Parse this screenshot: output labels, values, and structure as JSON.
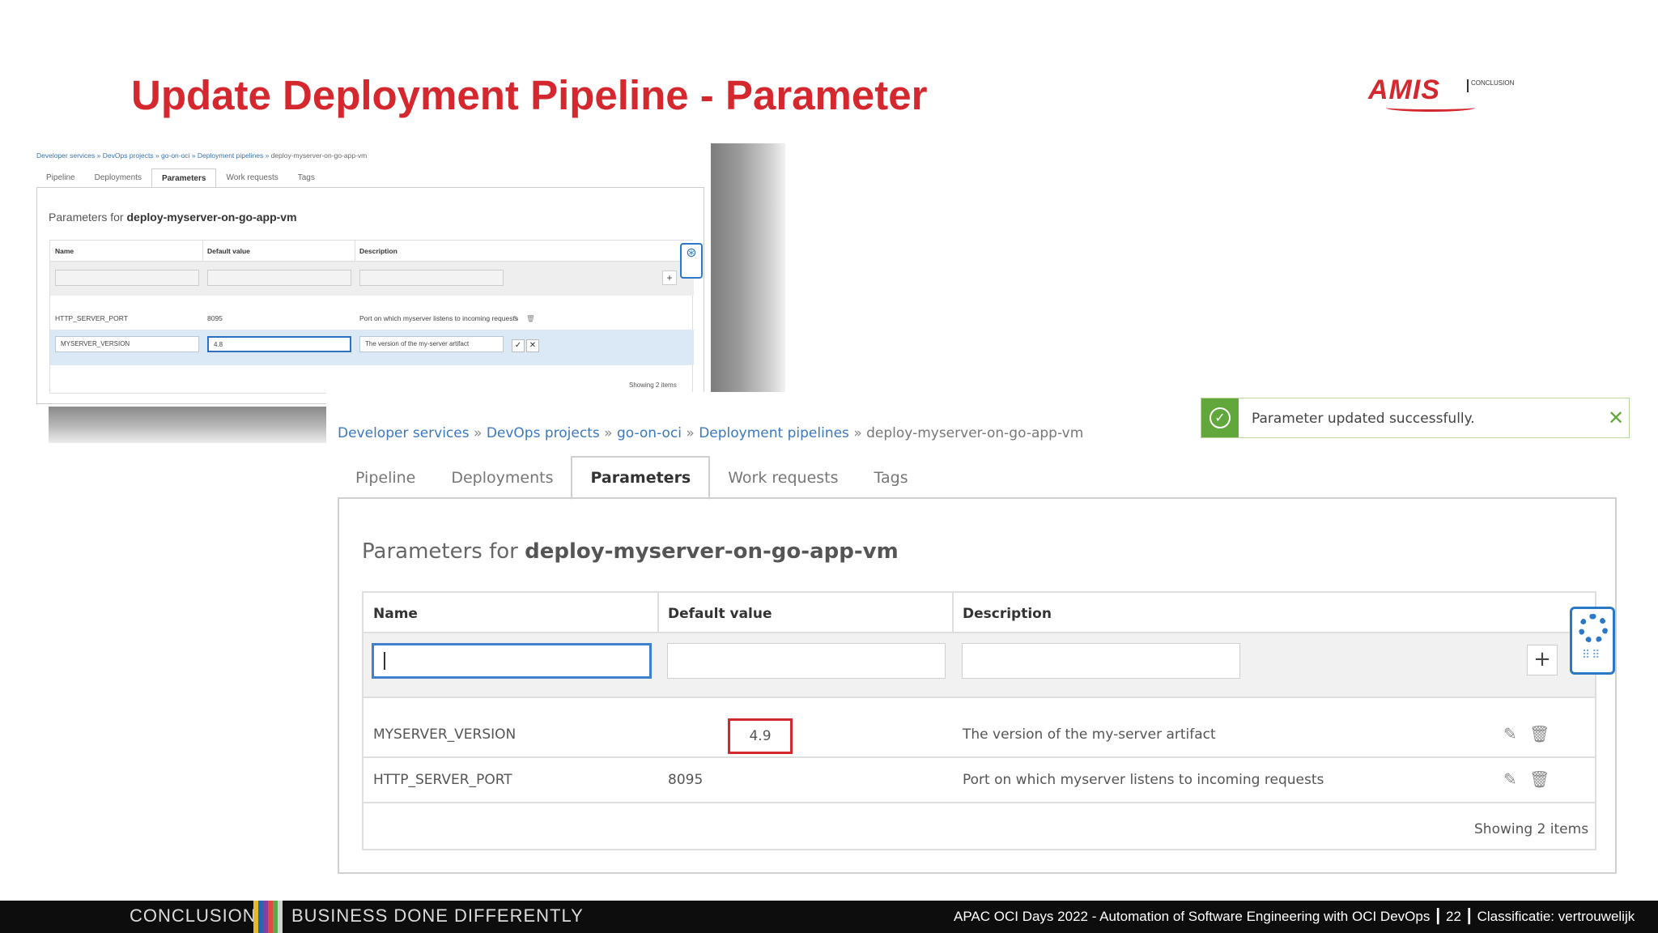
{
  "slide": {
    "title": "Update Deployment Pipeline - Parameter",
    "logo": {
      "text": "AMIS",
      "sub": "CONCLUSION"
    }
  },
  "small_screenshot": {
    "breadcrumb": [
      "Developer services",
      "DevOps projects",
      "go-on-oci",
      "Deployment pipelines",
      "deploy-myserver-on-go-app-vm"
    ],
    "tabs": [
      "Pipeline",
      "Deployments",
      "Parameters",
      "Work requests",
      "Tags"
    ],
    "active_tab": "Parameters",
    "panel_title_prefix": "Parameters for",
    "panel_title_name": "deploy-myserver-on-go-app-vm",
    "columns": [
      "Name",
      "Default value",
      "Description"
    ],
    "rows": [
      {
        "name": "HTTP_SERVER_PORT",
        "value": "8095",
        "description": "Port on which myserver listens to incoming requests"
      }
    ],
    "edit_row": {
      "name": "MYSERVER_VERSION",
      "value": "4.8",
      "description": "The version of the my-server artifact"
    },
    "showing": "Showing 2 items"
  },
  "large_screenshot": {
    "breadcrumb": [
      "Developer services",
      "DevOps projects",
      "go-on-oci",
      "Deployment pipelines",
      "deploy-myserver-on-go-app-vm"
    ],
    "toast": "Parameter updated successfully.",
    "tabs": [
      "Pipeline",
      "Deployments",
      "Parameters",
      "Work requests",
      "Tags"
    ],
    "active_tab": "Parameters",
    "panel_title_prefix": "Parameters for",
    "panel_title_name": "deploy-myserver-on-go-app-vm",
    "columns": [
      "Name",
      "Default value",
      "Description"
    ],
    "rows": [
      {
        "name": "MYSERVER_VERSION",
        "value": "4.9",
        "description": "The version of the my-server artifact"
      },
      {
        "name": "HTTP_SERVER_PORT",
        "value": "8095",
        "description": "Port on which myserver listens to incoming requests"
      }
    ],
    "showing": "Showing 2 items"
  },
  "footer": {
    "left1": "CONCLUSION",
    "left2": "BUSINESS DONE DIFFERENTLY",
    "right": "APAC OCI Days 2022 - Automation of Software Engineering with OCI DevOps  ┃  22 ┃ Classificatie: vertrouwelijk"
  },
  "colors": {
    "title": "#d4282e",
    "link": "#3a78c2",
    "success": "#62a73b",
    "highlight": "#d4282e",
    "footer": "#0d0d0d"
  }
}
